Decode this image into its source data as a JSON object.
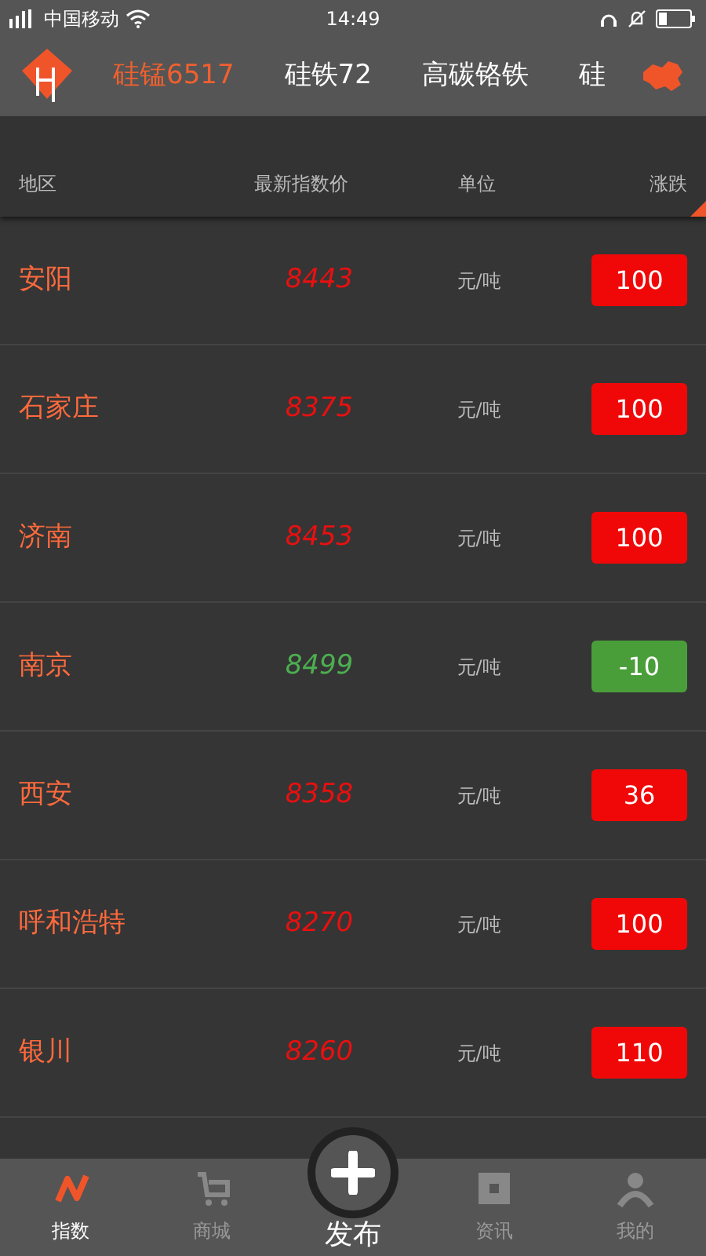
{
  "status_bar": {
    "carrier": "中国移动",
    "time": "14:49"
  },
  "tabs": [
    {
      "label": "硅锰6517",
      "selected": true
    },
    {
      "label": "硅铁72",
      "selected": false
    },
    {
      "label": "高碳铬铁",
      "selected": false
    },
    {
      "label": "硅",
      "selected": false
    }
  ],
  "table": {
    "columns": [
      "地区",
      "最新指数价",
      "单位",
      "涨跌"
    ],
    "rows": [
      {
        "region": "安阳",
        "price": "8443",
        "unit": "元/吨",
        "change": "100",
        "rising": true
      },
      {
        "region": "石家庄",
        "price": "8375",
        "unit": "元/吨",
        "change": "100",
        "rising": true
      },
      {
        "region": "济南",
        "price": "8453",
        "unit": "元/吨",
        "change": "100",
        "rising": true
      },
      {
        "region": "南京",
        "price": "8499",
        "unit": "元/吨",
        "change": "-10",
        "rising": false
      },
      {
        "region": "西安",
        "price": "8358",
        "unit": "元/吨",
        "change": "36",
        "rising": true
      },
      {
        "region": "呼和浩特",
        "price": "8270",
        "unit": "元/吨",
        "change": "100",
        "rising": true
      },
      {
        "region": "银川",
        "price": "8260",
        "unit": "元/吨",
        "change": "110",
        "rising": true
      }
    ]
  },
  "bottom_nav": [
    {
      "label": "指数",
      "kind": "chart",
      "selected": true
    },
    {
      "label": "商城",
      "kind": "cart",
      "selected": false
    },
    {
      "label": "发布",
      "kind": "publish",
      "selected": false
    },
    {
      "label": "资讯",
      "kind": "news",
      "selected": false
    },
    {
      "label": "我的",
      "kind": "person",
      "selected": false
    }
  ]
}
